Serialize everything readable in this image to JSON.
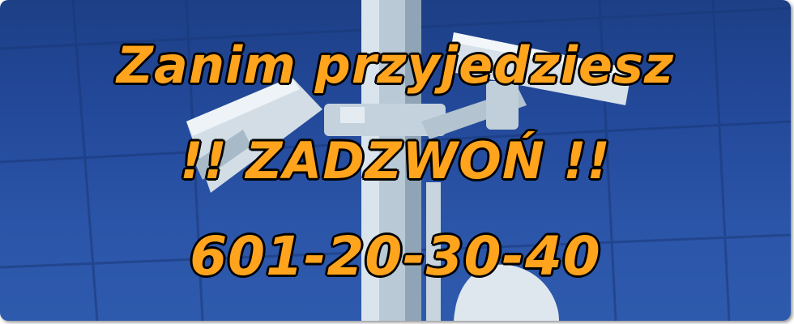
{
  "banner": {
    "line1": "Zanim przyjedziesz",
    "line2": "!! ZADZWOŃ !!",
    "line3": "601-20-30-40"
  },
  "colors": {
    "sky": "#2a53a6",
    "text": "#ffa41c",
    "outline": "#000000"
  },
  "icons": {
    "background": "cctv-camera-pole-photo"
  }
}
